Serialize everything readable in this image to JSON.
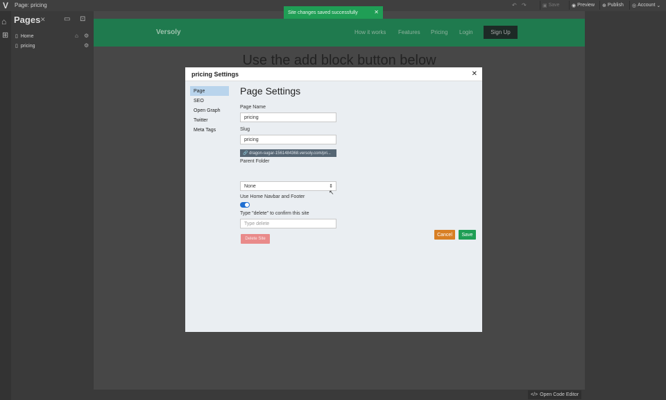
{
  "app": {
    "window_title": "Page: pricing"
  },
  "topbar": {
    "save_label": "Save",
    "preview_label": "Preview",
    "publish_label": "Publish",
    "account_label": "Account"
  },
  "toast": {
    "message": "Site changes saved successfully"
  },
  "sidebar": {
    "title": "Pages",
    "pages": [
      {
        "label": "Home"
      },
      {
        "label": "pricing"
      }
    ]
  },
  "site": {
    "brand": "Versoly",
    "nav_links": [
      "How it works",
      "Features",
      "Pricing",
      "Login"
    ],
    "signup_label": "Sign Up",
    "heading": "Use the add block button below"
  },
  "code_editor": {
    "label": "Open Code Editor"
  },
  "modal": {
    "title": "pricing Settings",
    "heading": "Page Settings",
    "tabs": [
      "Page",
      "SEO",
      "Open Graph",
      "Twitter",
      "Meta Tags"
    ],
    "active_tab": "Page",
    "page_name_label": "Page Name",
    "page_name_value": "pricing",
    "slug_label": "Slug",
    "slug_value": "pricing",
    "url": "dragon-sugar-1561484368.versoly.com/pri...",
    "parent_folder_label": "Parent Folder",
    "parent_folder_value": "None",
    "navbar_footer_label": "Use Home Navbar and Footer",
    "navbar_footer_enabled": true,
    "delete_confirm_label": "Type \"delete\" to confirm this site",
    "delete_confirm_placeholder": "Type delete",
    "delete_label": "Delete Site",
    "cancel_label": "Cancel",
    "save_label": "Save"
  },
  "colors": {
    "accent_green": "#1f9e55",
    "site_nav_green": "#1f7a4e",
    "cancel_orange": "#d87f24",
    "delete_red": "#e98a8a",
    "tab_active": "#b9d4ec",
    "toggle_blue": "#1f6fd1"
  }
}
